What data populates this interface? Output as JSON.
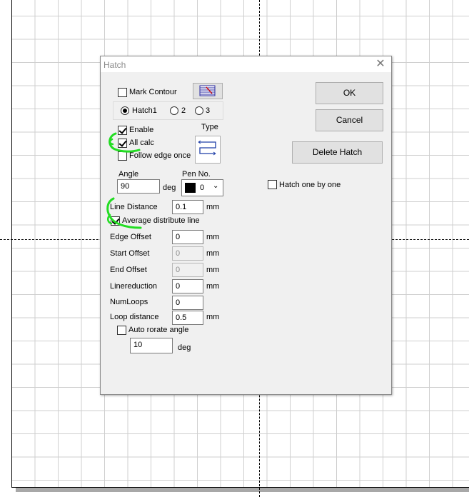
{
  "dialog": {
    "title": "Hatch",
    "close_glyph": "✕"
  },
  "mark_contour": {
    "label": "Mark Contour",
    "checked": false
  },
  "hatch_tabs": [
    {
      "label": "Hatch1",
      "selected": true
    },
    {
      "label": "2",
      "selected": false
    },
    {
      "label": "3",
      "selected": false
    }
  ],
  "enable": {
    "label": "Enable",
    "checked": true
  },
  "all_calc": {
    "label": "All calc",
    "checked": true
  },
  "follow_edge_once": {
    "label": "Follow edge once",
    "checked": false
  },
  "type_label": "Type",
  "angle": {
    "label": "Angle",
    "value": "90",
    "unit": "deg"
  },
  "pen": {
    "label": "Pen No.",
    "value": "0",
    "swatch_color": "#000000"
  },
  "hatch_one_by_one": {
    "label": "Hatch one by one",
    "checked": false
  },
  "line_distance": {
    "label": "Line Distance",
    "value": "0.1",
    "unit": "mm"
  },
  "average_distribute_line": {
    "label": "Average distribute line",
    "checked": true
  },
  "edge_offset": {
    "label": "Edge Offset",
    "value": "0",
    "unit": "mm"
  },
  "start_offset": {
    "label": "Start Offset",
    "value": "0",
    "unit": "mm"
  },
  "end_offset": {
    "label": "End Offset",
    "value": "0",
    "unit": "mm"
  },
  "linereduction": {
    "label": "Linereduction",
    "value": "0",
    "unit": "mm"
  },
  "num_loops": {
    "label": "NumLoops",
    "value": "0"
  },
  "loop_distance": {
    "label": "Loop distance",
    "value": "0.5",
    "unit": "mm"
  },
  "auto_rotate": {
    "label": "Auto rorate angle",
    "checked": false,
    "value": "10",
    "unit": "deg"
  },
  "buttons": {
    "ok": "OK",
    "cancel": "Cancel",
    "delete_hatch": "Delete Hatch"
  },
  "colors": {
    "highlight": "#22dd22",
    "dialog_bg": "#f0f0f0"
  }
}
